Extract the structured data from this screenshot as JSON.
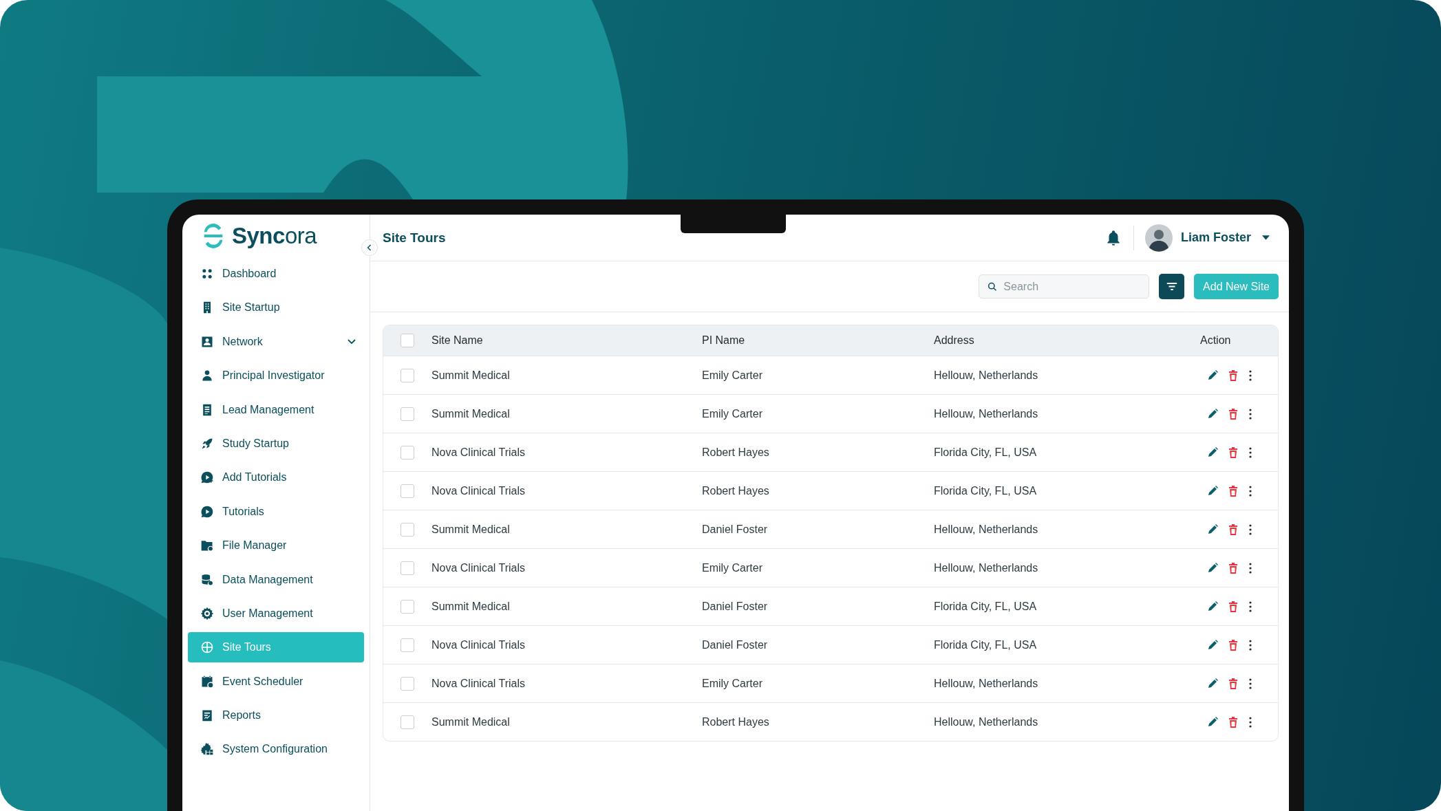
{
  "brand": {
    "name": "**Sync**ora"
  },
  "sidebar": {
    "items": [
      {
        "label": "Dashboard",
        "kind": "link",
        "selected": false
      },
      {
        "label": "Site Startup",
        "kind": "link",
        "selected": false
      },
      {
        "label": "Network",
        "kind": "group",
        "selected": false
      },
      {
        "label": "Principal Investigator",
        "kind": "link",
        "selected": false
      },
      {
        "label": "Lead Management",
        "kind": "link",
        "selected": false
      },
      {
        "label": "Study Startup",
        "kind": "link",
        "selected": false
      },
      {
        "label": "Add Tutorials",
        "kind": "link",
        "selected": false
      },
      {
        "label": "Tutorials",
        "kind": "link",
        "selected": false
      },
      {
        "label": "File Manager",
        "kind": "link",
        "selected": false
      },
      {
        "label": "Data Management",
        "kind": "link",
        "selected": false
      },
      {
        "label": "User Management",
        "kind": "link",
        "selected": false
      },
      {
        "label": "Site Tours",
        "kind": "link",
        "selected": true
      },
      {
        "label": "Event Scheduler",
        "kind": "link",
        "selected": false
      },
      {
        "label": "Reports",
        "kind": "link",
        "selected": false
      },
      {
        "label": "System Configuration",
        "kind": "link",
        "selected": false
      }
    ]
  },
  "header": {
    "title": "Site Tours",
    "user": {
      "name": "Liam Foster"
    }
  },
  "toolbar": {
    "search": {
      "placeholder": "Search"
    },
    "add_button": "Add New Site"
  },
  "table": {
    "columns": [
      "Site Name",
      "PI Name",
      "Address",
      "Action"
    ],
    "all_checked": false,
    "rows": [
      {
        "site_name": "Summit Medical",
        "pi_name": "Emily Carter",
        "address": "Hellouw, Netherlands",
        "checked": false
      },
      {
        "site_name": "Summit Medical",
        "pi_name": "Emily Carter",
        "address": "Hellouw, Netherlands",
        "checked": false
      },
      {
        "site_name": "Nova Clinical Trials",
        "pi_name": "Robert Hayes",
        "address": "Florida City, FL, USA",
        "checked": false
      },
      {
        "site_name": "Nova Clinical Trials",
        "pi_name": "Robert Hayes",
        "address": "Florida City, FL, USA",
        "checked": false
      },
      {
        "site_name": "Summit Medical",
        "pi_name": "Daniel Foster",
        "address": "Hellouw, Netherlands",
        "checked": false
      },
      {
        "site_name": "Nova Clinical Trials",
        "pi_name": "Emily Carter",
        "address": "Hellouw, Netherlands",
        "checked": false
      },
      {
        "site_name": "Summit Medical",
        "pi_name": "Daniel Foster",
        "address": "Florida City, FL, USA",
        "checked": false
      },
      {
        "site_name": "Nova Clinical Trials",
        "pi_name": "Daniel Foster",
        "address": "Florida City, FL, USA",
        "checked": false
      },
      {
        "site_name": "Nova Clinical Trials",
        "pi_name": "Emily Carter",
        "address": "Hellouw, Netherlands",
        "checked": false
      },
      {
        "site_name": "Summit Medical",
        "pi_name": "Robert Hayes",
        "address": "Hellouw, Netherlands",
        "checked": false
      }
    ]
  }
}
